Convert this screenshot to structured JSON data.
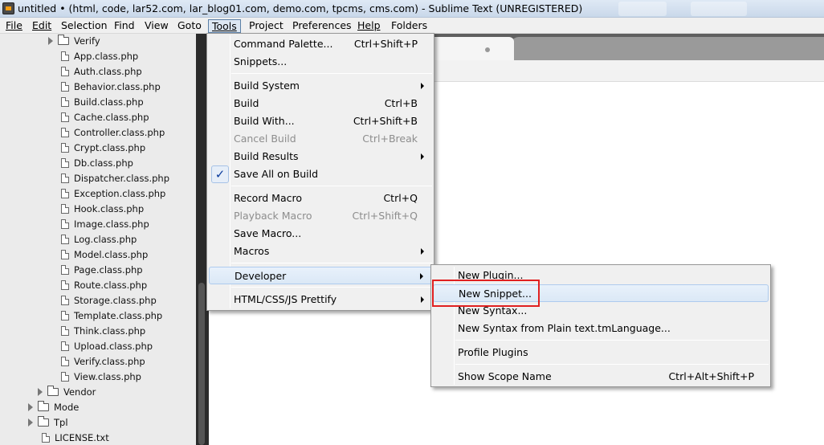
{
  "window": {
    "title": "untitled • (html, code, lar52.com, lar_blog01.com, demo.com, tpcms, cms.com) - Sublime Text (UNREGISTERED)"
  },
  "menubar": {
    "items": [
      "File",
      "Edit",
      "Selection",
      "Find",
      "View",
      "Goto",
      "Tools",
      "Project",
      "Preferences",
      "Help",
      "Folders"
    ],
    "active": "Tools"
  },
  "sidebar": {
    "verify_folder": "Verify",
    "files": [
      "App.class.php",
      "Auth.class.php",
      "Behavior.class.php",
      "Build.class.php",
      "Cache.class.php",
      "Controller.class.php",
      "Crypt.class.php",
      "Db.class.php",
      "Dispatcher.class.php",
      "Exception.class.php",
      "Hook.class.php",
      "Image.class.php",
      "Log.class.php",
      "Model.class.php",
      "Page.class.php",
      "Route.class.php",
      "Storage.class.php",
      "Template.class.php",
      "Think.class.php",
      "Upload.class.php",
      "Verify.class.php",
      "View.class.php"
    ],
    "vendor_folder": "Vendor",
    "mode_folder": "Mode",
    "tpl_folder": "Tpl",
    "license_file": "LICENSE.txt"
  },
  "tools_menu": {
    "items": [
      {
        "label": "Command Palette...",
        "shortcut": "Ctrl+Shift+P"
      },
      {
        "label": "Snippets...",
        "shortcut": ""
      },
      {
        "label": "Build System",
        "shortcut": "",
        "submenu": true
      },
      {
        "label": "Build",
        "shortcut": "Ctrl+B"
      },
      {
        "label": "Build With...",
        "shortcut": "Ctrl+Shift+B"
      },
      {
        "label": "Cancel Build",
        "shortcut": "Ctrl+Break",
        "disabled": true
      },
      {
        "label": "Build Results",
        "shortcut": "",
        "submenu": true
      },
      {
        "label": "Save All on Build",
        "shortcut": "",
        "checked": true
      },
      {
        "label": "Record Macro",
        "shortcut": "Ctrl+Q"
      },
      {
        "label": "Playback Macro",
        "shortcut": "Ctrl+Shift+Q",
        "disabled": true
      },
      {
        "label": "Save Macro...",
        "shortcut": ""
      },
      {
        "label": "Macros",
        "shortcut": "",
        "submenu": true
      },
      {
        "label": "Developer",
        "shortcut": "",
        "submenu": true,
        "hover": true
      },
      {
        "label": "HTML/CSS/JS Prettify",
        "shortcut": "",
        "submenu": true
      }
    ]
  },
  "developer_menu": {
    "items": [
      {
        "label": "New Plugin...",
        "shortcut": ""
      },
      {
        "label": "New Snippet...",
        "shortcut": "",
        "hover": true,
        "highlighted": true
      },
      {
        "label": "New Syntax...",
        "shortcut": ""
      },
      {
        "label": "New Syntax from Plain text.tmLanguage...",
        "shortcut": ""
      },
      {
        "label": "Profile Plugins",
        "shortcut": ""
      },
      {
        "label": "Show Scope Name",
        "shortcut": "Ctrl+Alt+Shift+P"
      }
    ]
  },
  "colors": {
    "highlight_border": "#e02020",
    "hover_bg": "#dbe8f6",
    "sidebar_bg": "#ebebeb"
  }
}
